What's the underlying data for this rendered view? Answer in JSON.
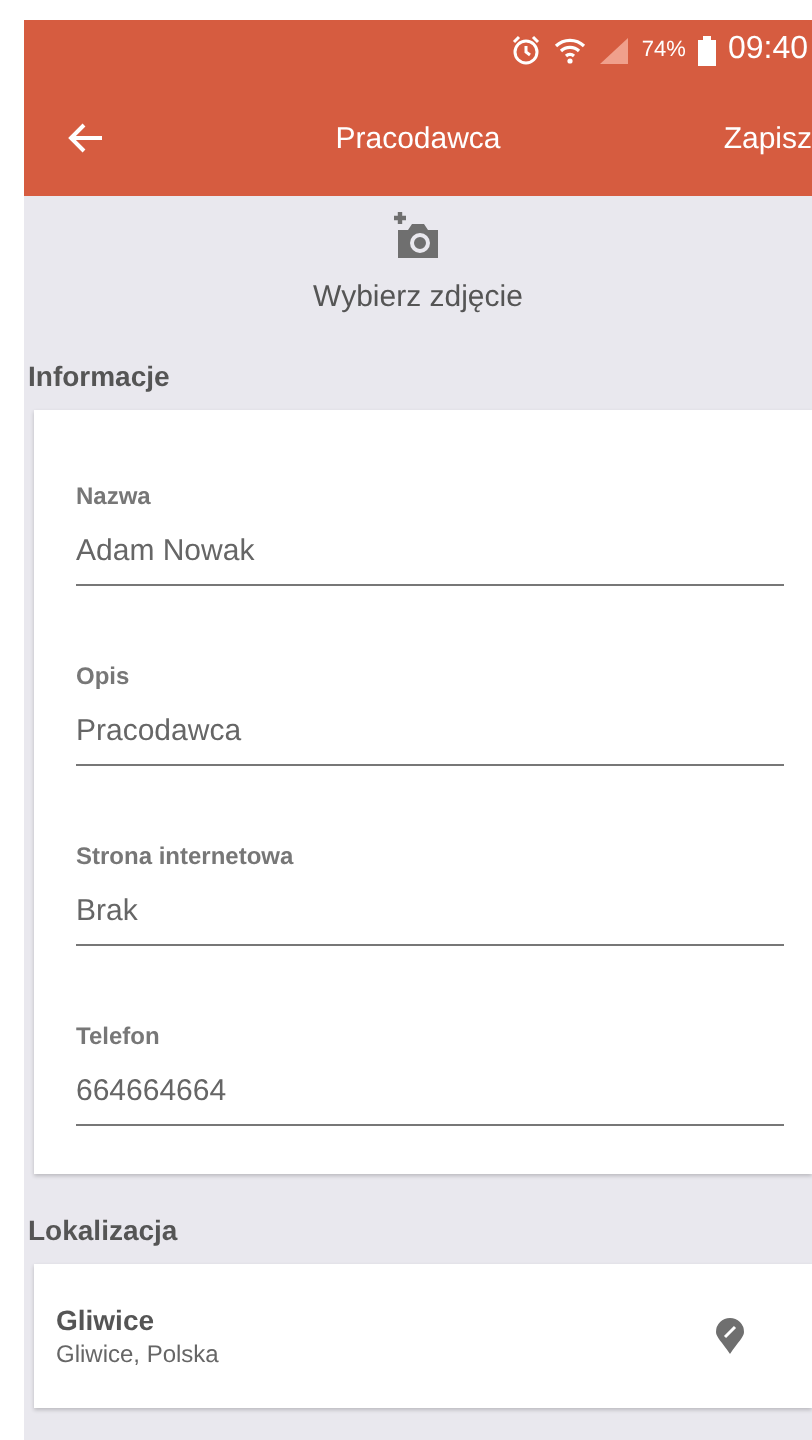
{
  "status_bar": {
    "battery": "74%",
    "time": "09:40"
  },
  "app_bar": {
    "title": "Pracodawca",
    "action": "Zapisz"
  },
  "photo": {
    "label": "Wybierz zdjęcie"
  },
  "info": {
    "title": "Informacje",
    "fields": [
      {
        "label": "Nazwa",
        "value": "Adam Nowak"
      },
      {
        "label": "Opis",
        "value": "Pracodawca"
      },
      {
        "label": "Strona internetowa",
        "value": "Brak"
      },
      {
        "label": "Telefon",
        "value": "664664664"
      }
    ]
  },
  "location": {
    "title": "Lokalizacja",
    "name": "Gliwice",
    "address": "Gliwice, Polska"
  }
}
